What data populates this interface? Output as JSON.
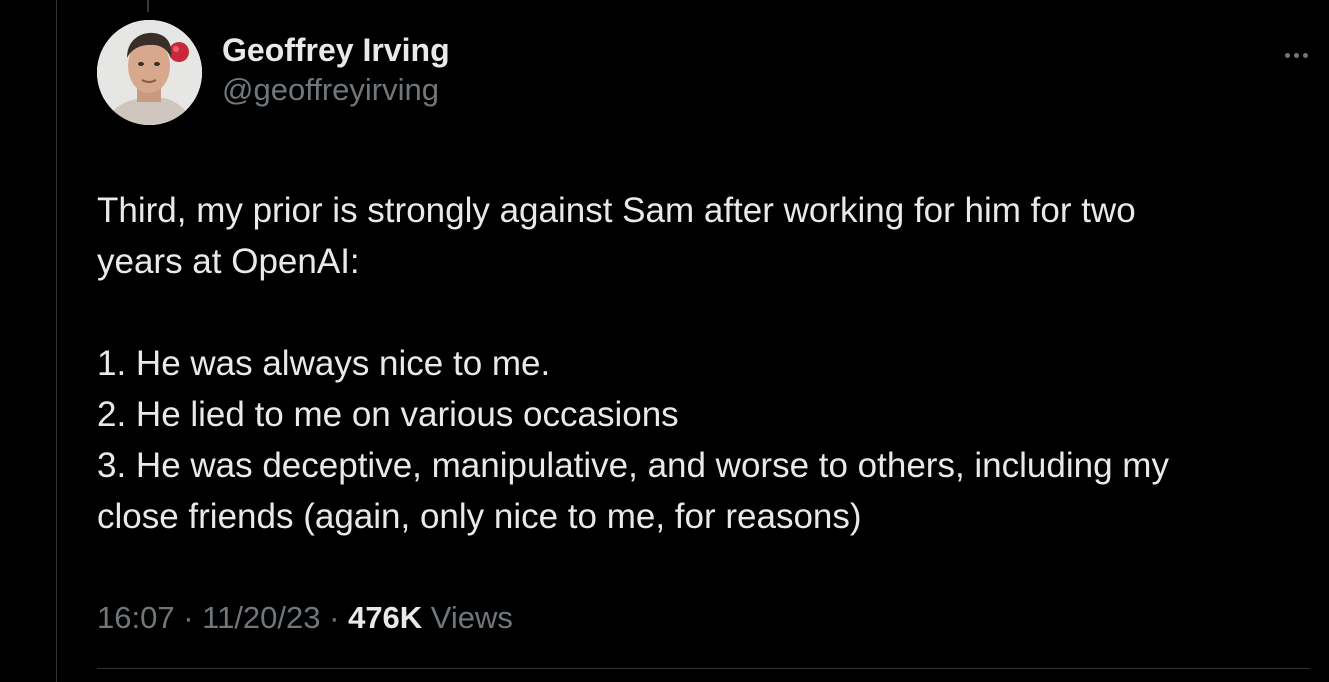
{
  "tweet": {
    "author": {
      "display_name": "Geoffrey Irving",
      "handle": "@geoffreyirving"
    },
    "more_icon": "more-horizontal-icon",
    "body": {
      "intro_line_1": "Third, my prior is strongly against Sam after working for him for two",
      "intro_line_2": "years at OpenAI:",
      "items": [
        "1. He was always nice to me.",
        "2. He lied to me on various occasions",
        "3. He was deceptive, manipulative, and worse to others, including my",
        "close friends (again, only nice to me, for reasons)"
      ]
    },
    "meta": {
      "time": "16:07",
      "sep1": " · ",
      "date": "11/20/23",
      "sep2": " · ",
      "views_count": "476K",
      "views_label": " Views"
    }
  },
  "colors": {
    "background": "#000000",
    "primary_text": "#e7e9ea",
    "secondary_text": "#71767b",
    "divider": "#2f3336"
  }
}
